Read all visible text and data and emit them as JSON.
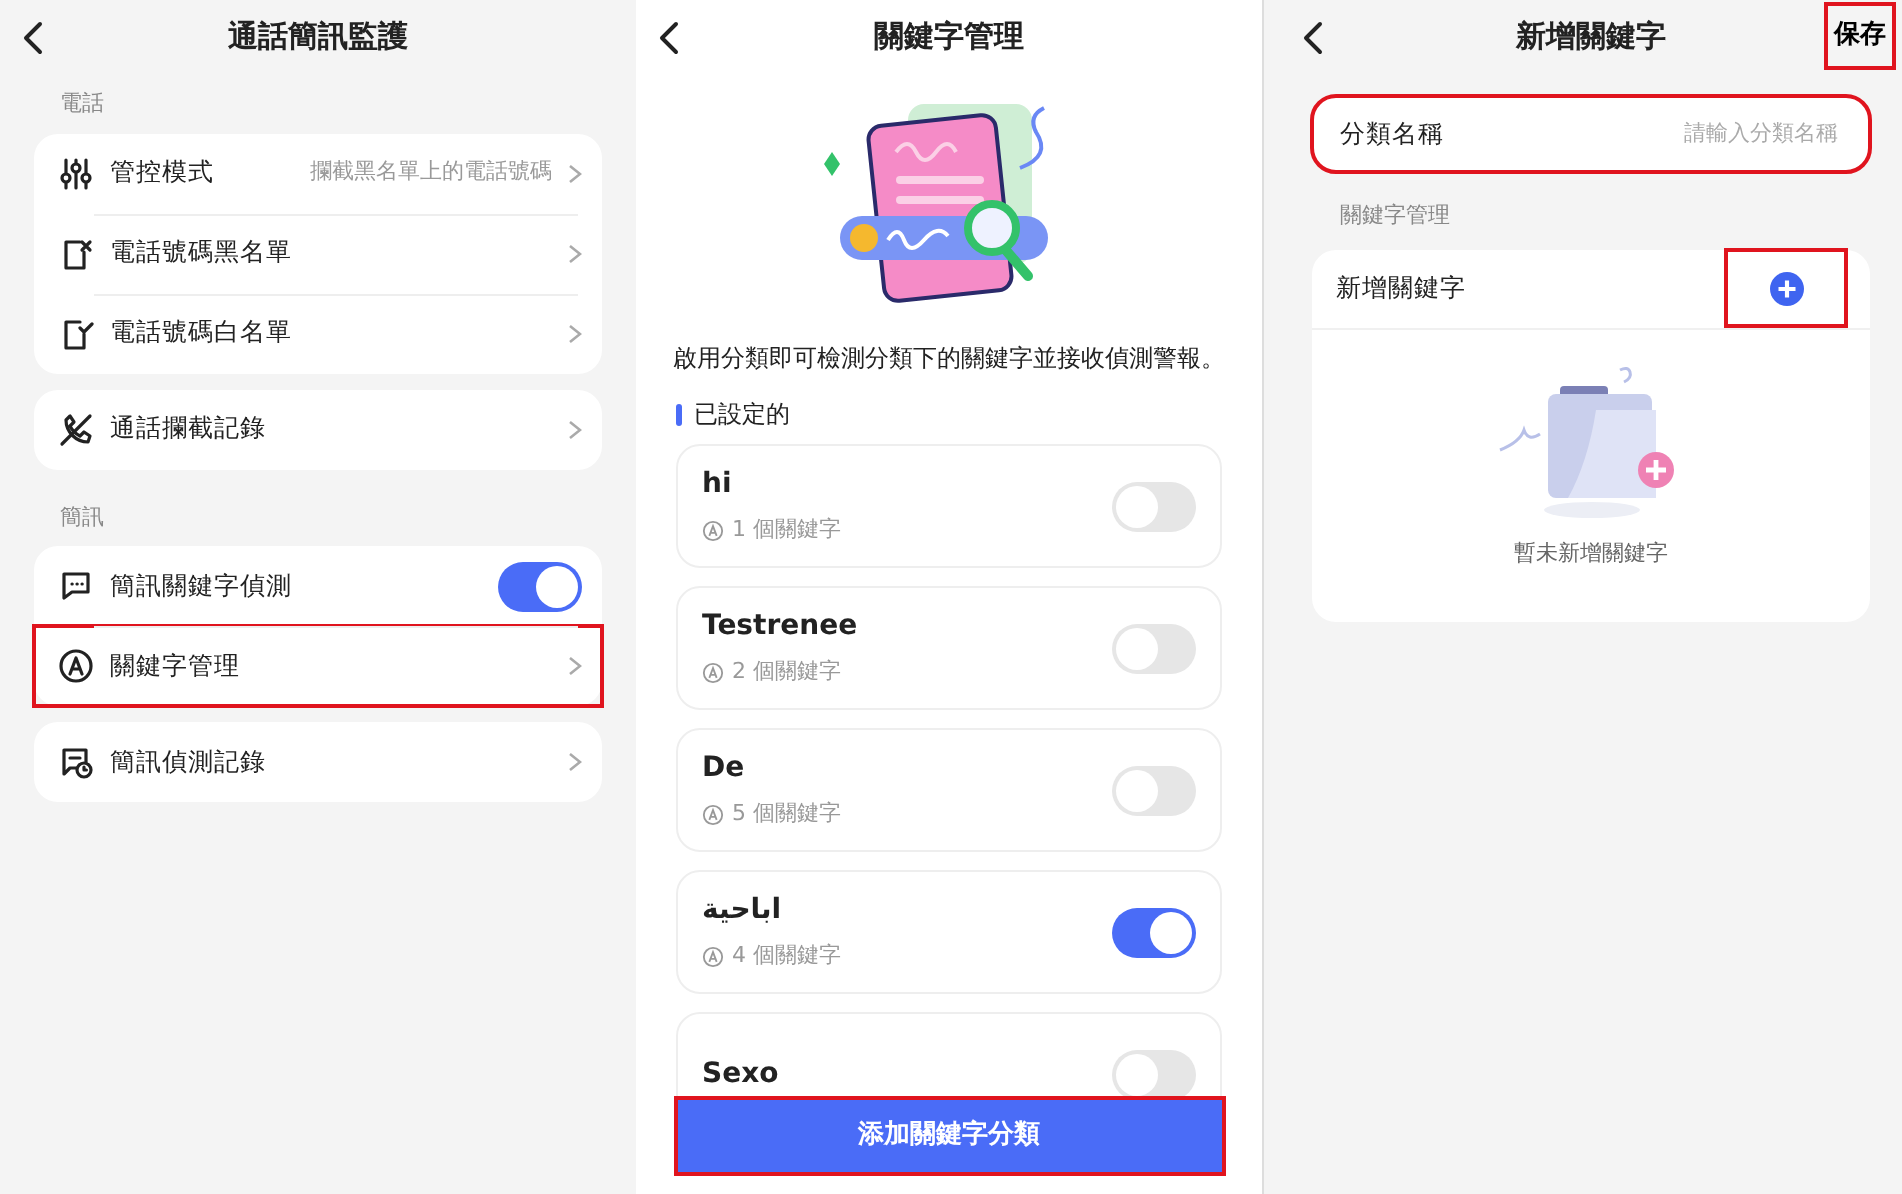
{
  "screens": [
    {
      "title": "通話簡訊監護",
      "sections": [
        {
          "heading": "電話",
          "groups": [
            [
              {
                "kind": "link",
                "label": "管控模式",
                "value": "攔截黑名單上的電話號碼",
                "highlighted": false
              },
              {
                "kind": "link",
                "label": "電話號碼黑名單",
                "highlighted": false
              },
              {
                "kind": "link",
                "label": "電話號碼白名單",
                "highlighted": false
              }
            ],
            [
              {
                "kind": "link",
                "label": "通話攔截記錄",
                "highlighted": false
              }
            ]
          ]
        },
        {
          "heading": "簡訊",
          "groups": [
            [
              {
                "kind": "toggle",
                "label": "簡訊關鍵字偵測",
                "on": true,
                "highlighted": false
              },
              {
                "kind": "link",
                "label": "關鍵字管理",
                "highlighted": true
              }
            ],
            [
              {
                "kind": "link",
                "label": "簡訊偵測記錄",
                "highlighted": false
              }
            ]
          ]
        }
      ]
    },
    {
      "title": "關鍵字管理",
      "description": "啟用分類即可檢測分類下的關鍵字並接收偵測警報。",
      "section_label": "已設定的",
      "categories": [
        {
          "name": "hi",
          "count": "1 個關鍵字",
          "on": false
        },
        {
          "name": "Testrenee",
          "count": "2 個關鍵字",
          "on": false
        },
        {
          "name": "De",
          "count": "5 個關鍵字",
          "on": false
        },
        {
          "name": "اباحية",
          "count": "4 個關鍵字",
          "on": true
        },
        {
          "name": "Sexo",
          "on": false
        }
      ],
      "button": {
        "label": "添加關鍵字分類",
        "highlighted": true
      }
    },
    {
      "title": "新增關鍵字",
      "save": {
        "label": "保存",
        "highlighted": true
      },
      "field": {
        "label": "分類名稱",
        "placeholder": "請輸入分類名稱",
        "highlighted": true
      },
      "section_label": "關鍵字管理",
      "keyword_card": {
        "label": "新增關鍵字",
        "add_highlighted": true,
        "empty_text": "暫未新增關鍵字"
      }
    }
  ]
}
